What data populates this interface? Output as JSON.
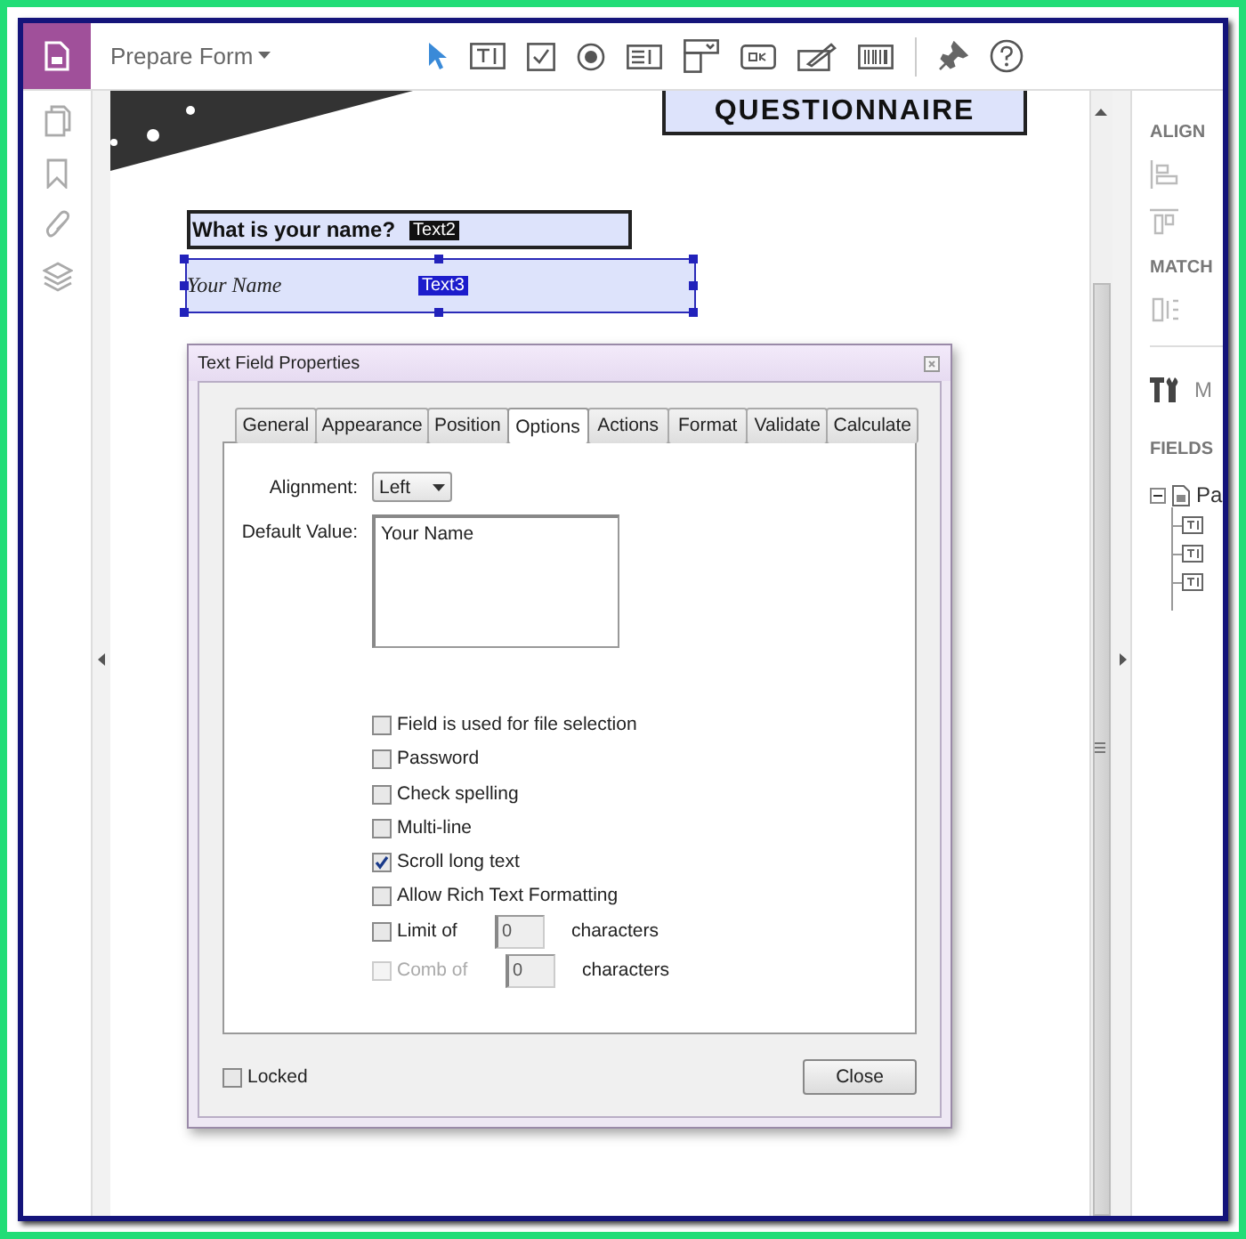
{
  "toolbar": {
    "title": "Prepare Form"
  },
  "document": {
    "heading": "QUESTIONNAIRE",
    "fields": [
      {
        "kind": "label",
        "text": "What is your name?",
        "tag": "Text2",
        "selected": false
      },
      {
        "kind": "text-field",
        "text": "Your Name",
        "tag": "Text3",
        "selected": true
      }
    ]
  },
  "dialog": {
    "title": "Text Field Properties",
    "tabs": [
      {
        "label": "General",
        "selected": false
      },
      {
        "label": "Appearance",
        "selected": false
      },
      {
        "label": "Position",
        "selected": false
      },
      {
        "label": "Options",
        "selected": true
      },
      {
        "label": "Actions",
        "selected": false
      },
      {
        "label": "Format",
        "selected": false
      },
      {
        "label": "Validate",
        "selected": false
      },
      {
        "label": "Calculate",
        "selected": false
      }
    ],
    "alignment": {
      "label": "Alignment:",
      "value": "Left"
    },
    "default_value": {
      "label": "Default Value:",
      "value": "Your Name"
    },
    "option_groups": [
      [
        {
          "kind": "check",
          "label": "Field is used for file selection",
          "checked": false,
          "disabled": false
        },
        {
          "kind": "check",
          "label": "Password",
          "checked": false,
          "disabled": false
        }
      ],
      [
        {
          "kind": "check",
          "label": "Check spelling",
          "checked": false,
          "disabled": false
        },
        {
          "kind": "check",
          "label": "Multi-line",
          "checked": false,
          "disabled": false
        },
        {
          "kind": "check",
          "label": "Scroll long text",
          "checked": true,
          "disabled": false
        },
        {
          "kind": "check",
          "label": "Allow Rich Text Formatting",
          "checked": false,
          "disabled": false
        }
      ],
      [
        {
          "kind": "count",
          "label": "Limit of",
          "checked": false,
          "disabled": false,
          "value": "0",
          "unit": "characters"
        },
        {
          "kind": "count",
          "label": "Comb of",
          "checked": false,
          "disabled": true,
          "value": "0",
          "unit": "characters"
        }
      ]
    ],
    "locked": {
      "label": "Locked",
      "checked": false
    },
    "close_button": "Close"
  },
  "right_panel": {
    "sections": [
      "ALIGN",
      "MATCH"
    ],
    "tool_label": "M",
    "fields_heading": "FIELDS",
    "tree": {
      "label": "Pa",
      "expanded": true,
      "children": [
        {
          "kind": "text-field"
        },
        {
          "kind": "text-field"
        },
        {
          "kind": "text-field"
        }
      ]
    }
  }
}
